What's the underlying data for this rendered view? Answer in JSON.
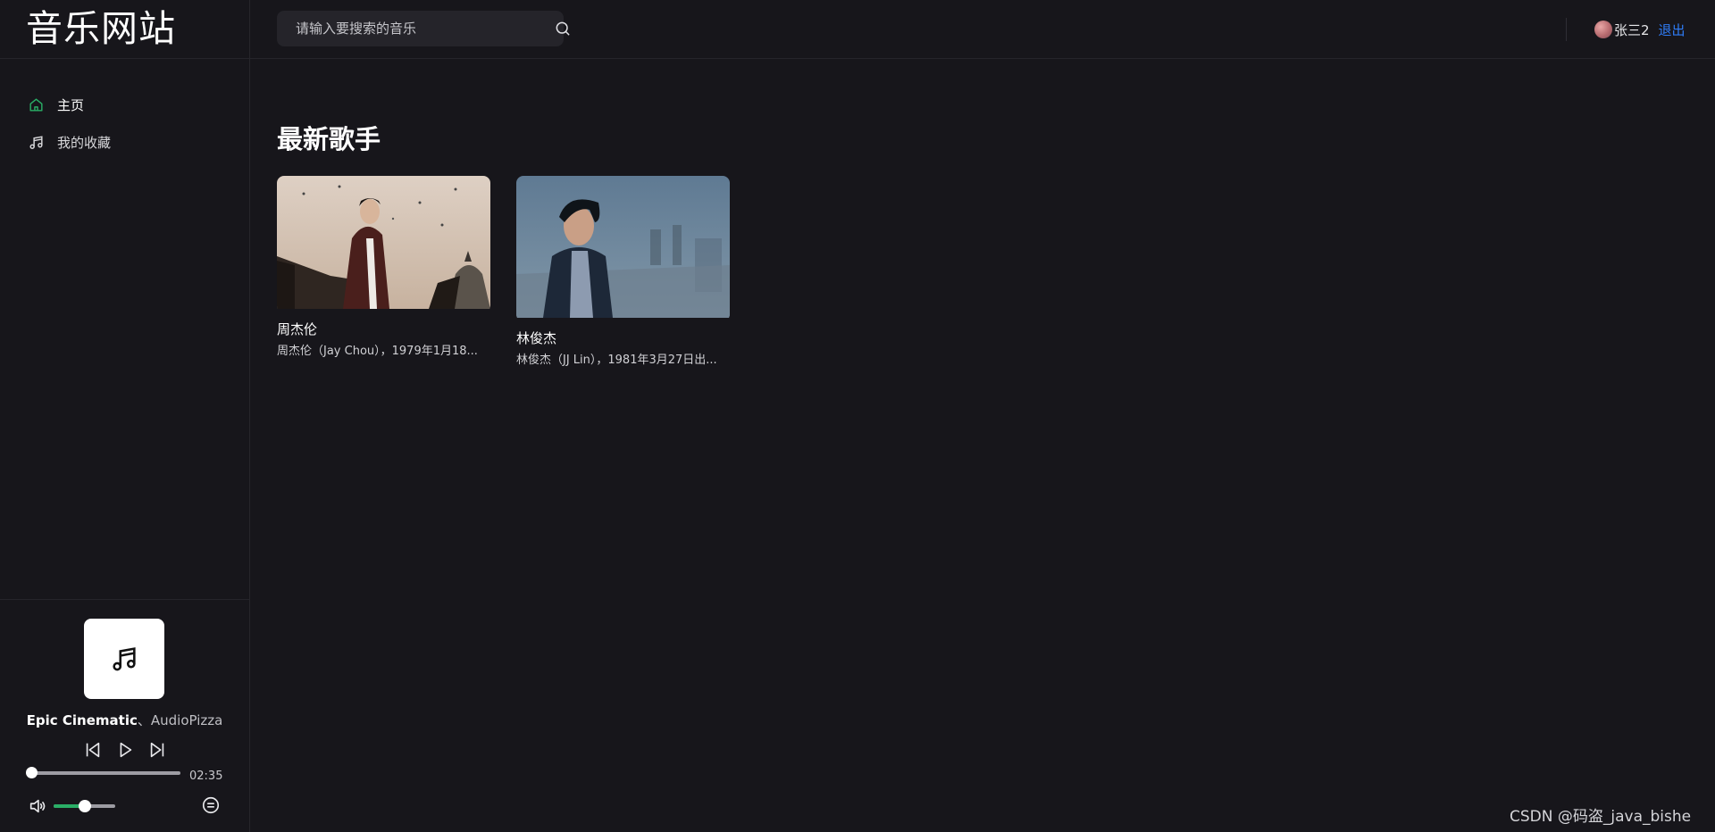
{
  "brand": {
    "title": "音乐网站"
  },
  "nav": {
    "items": [
      {
        "label": "主页",
        "icon": "home-icon",
        "active": true
      },
      {
        "label": "我的收藏",
        "icon": "music-note-icon",
        "active": false
      }
    ]
  },
  "search": {
    "placeholder": "请输入要搜索的音乐",
    "value": ""
  },
  "user": {
    "name": "张三2",
    "logout_label": "退出"
  },
  "main": {
    "section_title": "最新歌手",
    "singers": [
      {
        "name": "周杰伦",
        "description": "周杰伦（Jay Chou），1979年1月18..."
      },
      {
        "name": "林俊杰",
        "description": "林俊杰（JJ Lin），1981年3月27日出..."
      }
    ]
  },
  "player": {
    "title": "Epic Cinematic",
    "separator": "、",
    "artist": "AudioPizza",
    "duration": "02:35",
    "progress_fraction": 0.0,
    "volume_fraction": 0.5
  },
  "colors": {
    "background": "#17161b",
    "accent_green": "#2aae66",
    "link_blue": "#2f7cf6"
  },
  "watermark": "CSDN @码盗_java_bishe"
}
